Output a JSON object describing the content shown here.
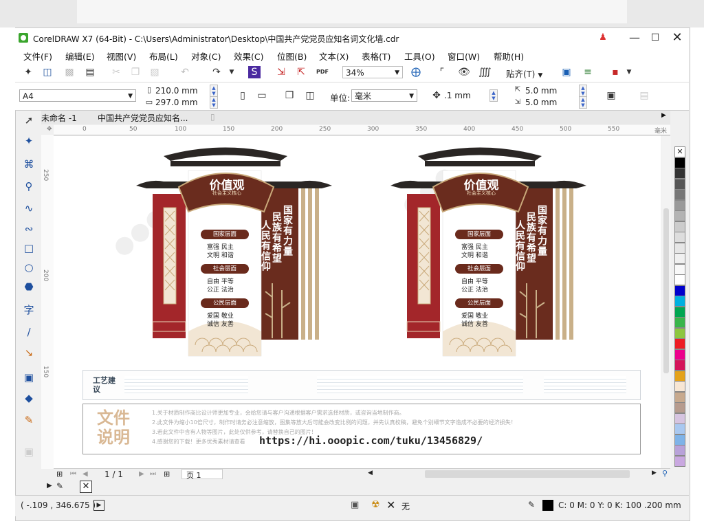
{
  "window": {
    "title": "CorelDRAW X7 (64-Bit) - C:\\Users\\Administrator\\Desktop\\中国共产党党员应知名词文化墙.cdr"
  },
  "menu": [
    "文件(F)",
    "编辑(E)",
    "视图(V)",
    "布局(L)",
    "对象(C)",
    "效果(C)",
    "位图(B)",
    "文本(X)",
    "表格(T)",
    "工具(O)",
    "窗口(W)",
    "帮助(H)"
  ],
  "toolbar": {
    "zoom": "34%",
    "snap_label": "贴齐(T)"
  },
  "property_bar": {
    "paper_size": "A4",
    "width": "210.0 mm",
    "height": "297.0 mm",
    "unit_label": "单位:",
    "unit_value": "毫米",
    "nudge": ".1 mm",
    "dup_x": "5.0 mm",
    "dup_y": "5.0 mm"
  },
  "tabs": [
    "未命名 -1",
    "中国共产党党员应知名..."
  ],
  "ruler": {
    "h_ticks": [
      "0",
      "50",
      "100",
      "150",
      "200",
      "250",
      "300",
      "350",
      "400",
      "450",
      "500",
      "550"
    ],
    "h_unit": "毫米",
    "v_ticks": [
      "250",
      "200",
      "150"
    ]
  },
  "design": {
    "title": "价值观",
    "subtitle": "社会主义核心",
    "slogans": [
      "国家有力量",
      "民族有希望",
      "人民有信仰"
    ],
    "sections": [
      {
        "label": "国家层面",
        "lines": [
          "富强  民主",
          "文明  和谐"
        ]
      },
      {
        "label": "社会层面",
        "lines": [
          "自由  平等",
          "公正  法治"
        ]
      },
      {
        "label": "公民层面",
        "lines": [
          "爱国  敬业",
          "诚信  友善"
        ]
      }
    ],
    "craft_title": "工艺建议",
    "file_title": "文件说明",
    "file_notes": [
      "1.关于材质制作商比设计师更加专业，会给您请与客户沟通根据客户需求选择材质，或咨询当地制作商。",
      "2.此文件为缩小10倍尺寸，制作时请务必注意缩放，图集等放大后可能会改变比例的问题，并先认真校稿，避免个别细节文字造成不必要的经济损失！",
      "3.若此文件中含有人物等图片，此处仅供参考，请替换自己的图片！",
      "4.感谢您的下载！更多优秀素材请查看"
    ],
    "url": "https://hi.ooopic.com/tuku/13456829/"
  },
  "pager": {
    "pages": "1 / 1",
    "page_tab": "页 1"
  },
  "status": {
    "coords": "( -.109 , 346.675 )",
    "fill_label": "无",
    "outline": "C: 0 M: 0 Y: 0 K: 100  .200 mm"
  },
  "palette": [
    "#ffffff",
    "#000000",
    "#333333",
    "#555555",
    "#777777",
    "#999999",
    "#b3b3b3",
    "#cccccc",
    "#dddddd",
    "#e6e6e6",
    "#f0f0f0",
    "#f8f8f8",
    "#ffffff",
    "#0000cc",
    "#00b0e0",
    "#00a651",
    "#39b54a",
    "#8dc63f",
    "#ed1c24",
    "#ec008c",
    "#d4145a",
    "#e4a21a",
    "#f7e6d4",
    "#c7a98e",
    "#b69b8e",
    "#d6c4e0",
    "#a9c8f0",
    "#7fb3e8",
    "#b8a2d9",
    "#c9a8e0"
  ]
}
